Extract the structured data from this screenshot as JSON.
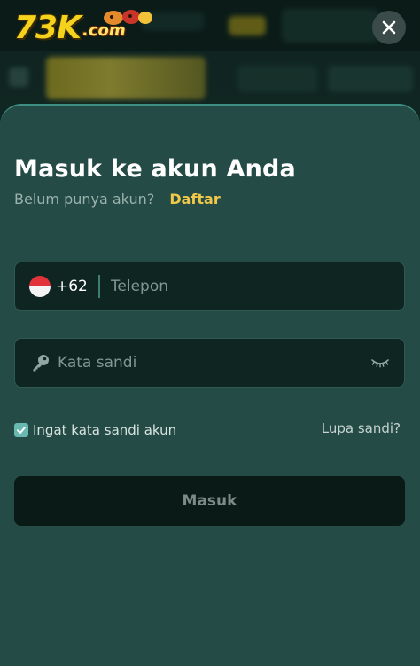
{
  "brand": {
    "logo_main": "73K",
    "logo_sub": ".com"
  },
  "header": {
    "close_icon": "close-icon"
  },
  "login": {
    "title": "Masuk ke akun Anda",
    "subtitle": "Belum punya akun?",
    "signup_link": "Daftar",
    "phone": {
      "country_code": "+62",
      "flag_icon": "indonesia-flag-icon",
      "placeholder": "Telepon",
      "value": ""
    },
    "password": {
      "placeholder": "Kata sandi",
      "value": "",
      "key_icon": "key-icon",
      "visibility_icon": "eye-closed-icon"
    },
    "remember": {
      "label": "Ingat kata sandi akun",
      "checked": true
    },
    "forgot_link": "Lupa sandi?",
    "submit_label": "Masuk"
  },
  "colors": {
    "accent_gold": "#f0c84a",
    "sheet_bg": "#244b45",
    "field_bg": "#0f2522",
    "button_bg": "#0a1a17",
    "checkbox": "#68b9b1"
  }
}
